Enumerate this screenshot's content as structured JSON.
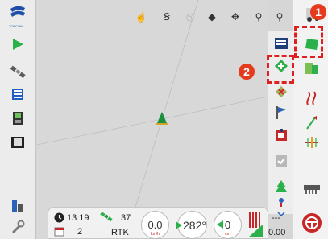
{
  "brand": {
    "logo_text": "TOPCON"
  },
  "top_toolbar": {
    "items": [
      {
        "name": "touch-pan-icon",
        "glyph": "☝"
      },
      {
        "name": "swath-icon",
        "glyph": "Ꞩ"
      },
      {
        "name": "target-icon",
        "glyph": "◎"
      },
      {
        "name": "layers-icon",
        "glyph": "◆"
      },
      {
        "name": "pan-arrows-icon",
        "glyph": "✥"
      },
      {
        "name": "zoom-out-icon",
        "glyph": "⚲"
      },
      {
        "name": "zoom-in-icon",
        "glyph": "⚲"
      }
    ]
  },
  "callouts": {
    "first": "1",
    "second": "2"
  },
  "status": {
    "time": "13:19",
    "satellites": "37",
    "date_day": "2",
    "correction": "RTK",
    "speed_value": "0.0",
    "speed_unit": "km/h",
    "heading_value": "282°",
    "cross_track_value": "0",
    "cross_track_unit": "cm",
    "area_top": "---",
    "area_value": "0.00"
  },
  "colors": {
    "accent_green": "#2bb04a",
    "alert_red": "#c62828",
    "callout_red": "#e02020",
    "brand_blue": "#1f4fa8"
  }
}
